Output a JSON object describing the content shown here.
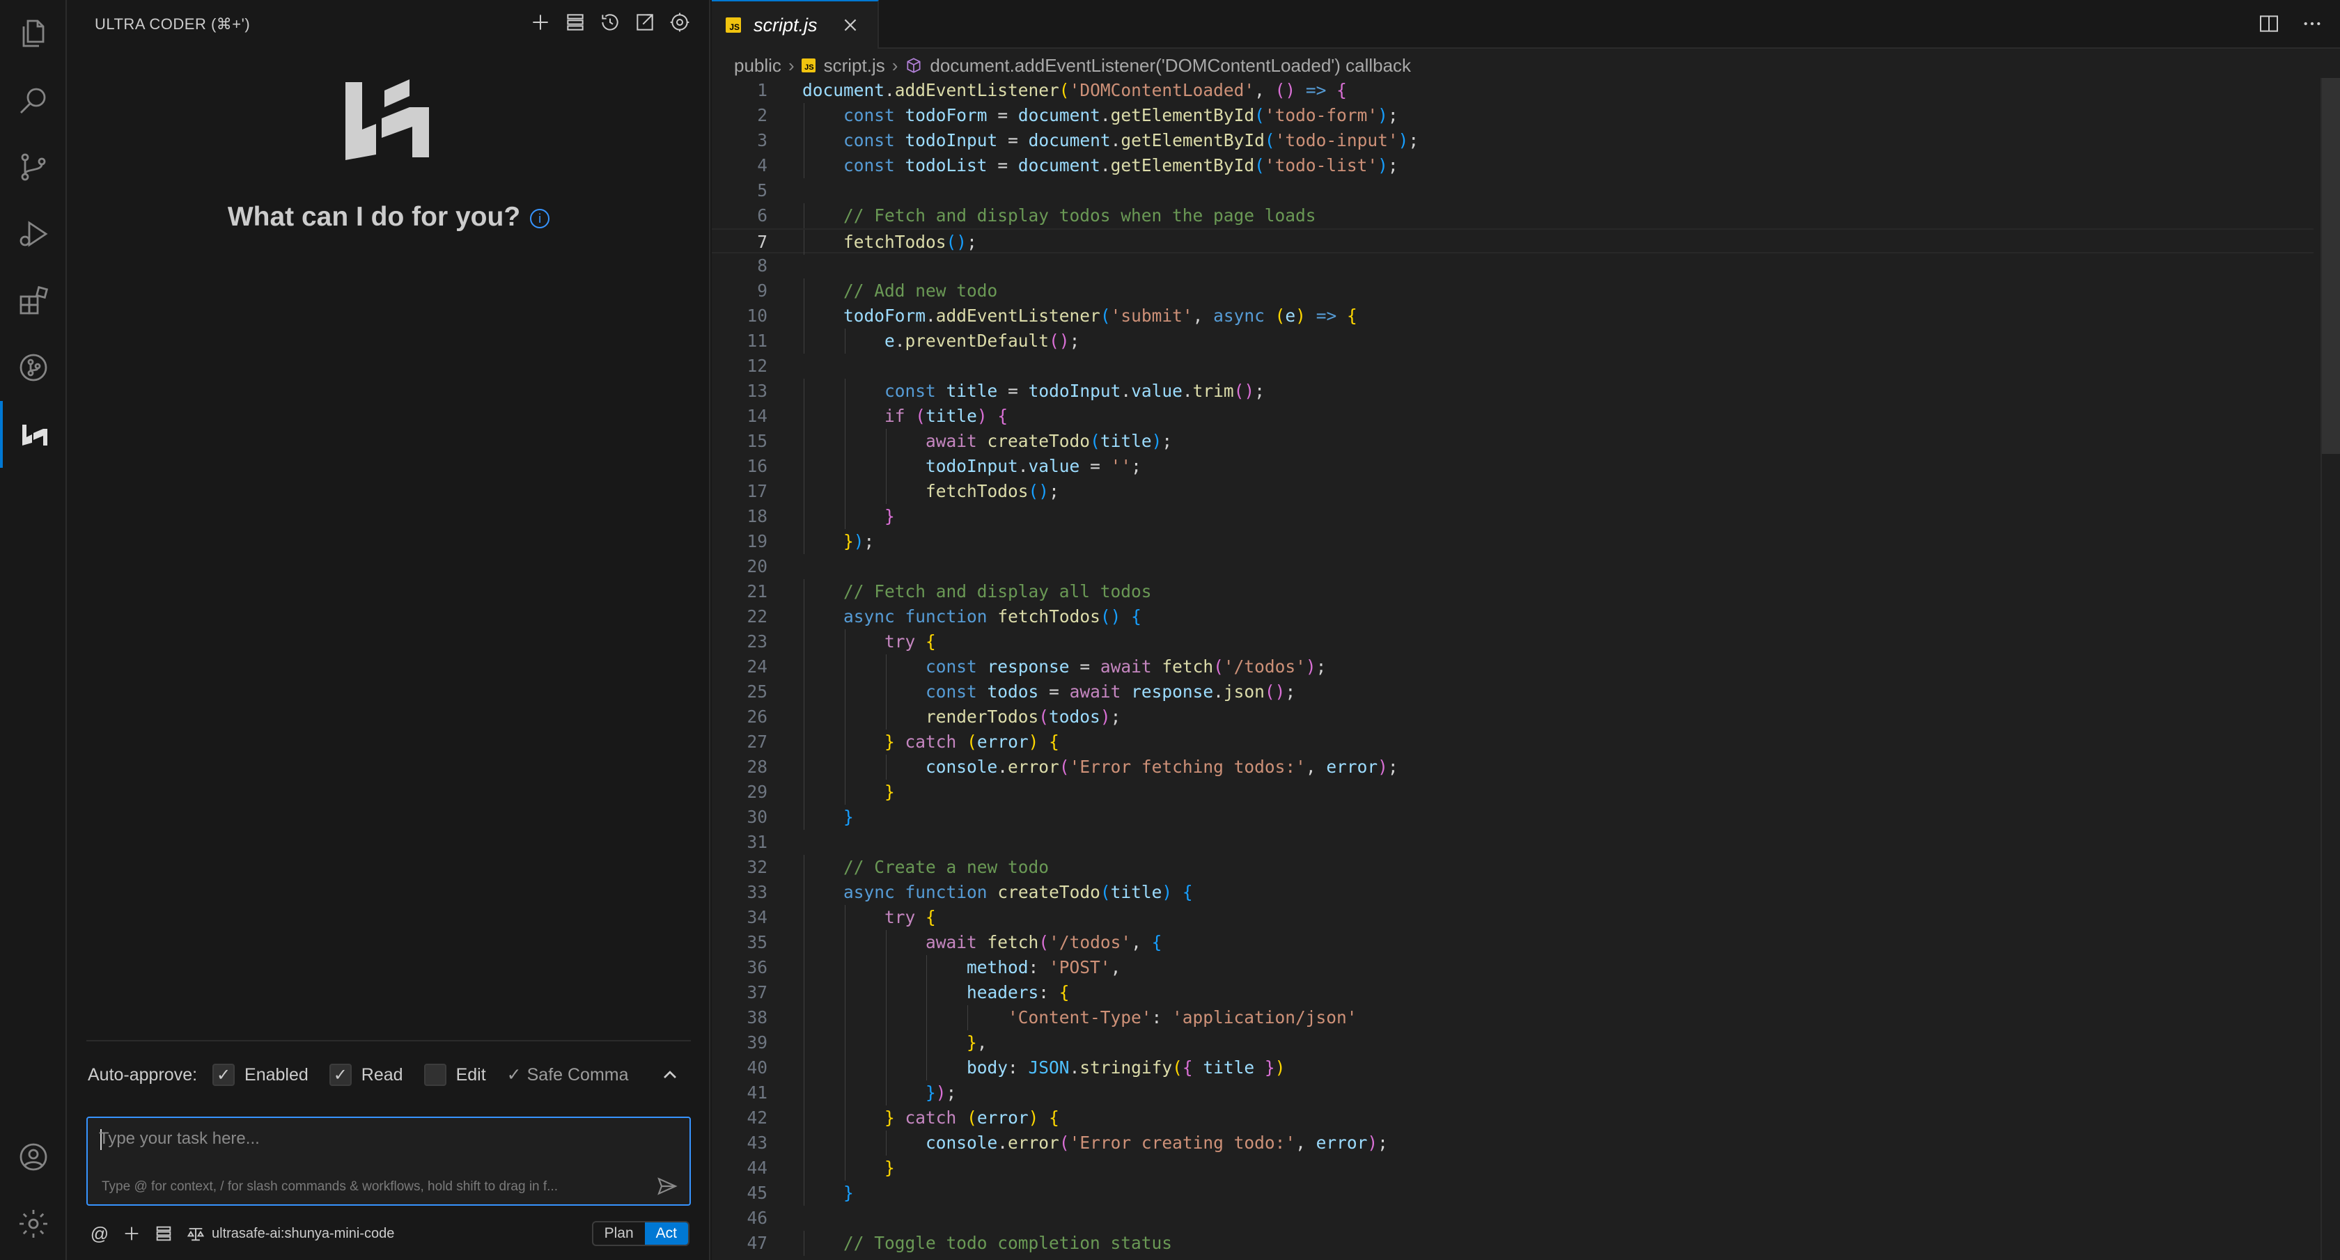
{
  "sidebar": {
    "title": "ULTRA CODER (⌘+')",
    "greeting": "What can I do for you?",
    "auto_approve": {
      "label": "Auto-approve:",
      "items": [
        {
          "label": "Enabled",
          "checked": true
        },
        {
          "label": "Read",
          "checked": true
        },
        {
          "label": "Edit",
          "checked": false
        }
      ],
      "safe_commands": "Safe Comma"
    },
    "task_input": {
      "placeholder": "Type your task here...",
      "hint": "Type @ for context, / for slash commands & workflows, hold shift to drag in f..."
    },
    "model": "ultrasafe-ai:shunya-mini-code",
    "mode": {
      "plan": "Plan",
      "act": "Act",
      "selected": "Act"
    }
  },
  "editor": {
    "tab": {
      "file_name": "script.js",
      "badge": "JS"
    },
    "breadcrumb": {
      "folder": "public",
      "file": "script.js",
      "symbol": "document.addEventListener('DOMContentLoaded') callback"
    },
    "current_line": 7,
    "code_lines": [
      "document.addEventListener('DOMContentLoaded', () => {",
      "    const todoForm = document.getElementById('todo-form');",
      "    const todoInput = document.getElementById('todo-input');",
      "    const todoList = document.getElementById('todo-list');",
      "",
      "    // Fetch and display todos when the page loads",
      "    fetchTodos();",
      "",
      "    // Add new todo",
      "    todoForm.addEventListener('submit', async (e) => {",
      "        e.preventDefault();",
      "",
      "        const title = todoInput.value.trim();",
      "        if (title) {",
      "            await createTodo(title);",
      "            todoInput.value = '';",
      "            fetchTodos();",
      "        }",
      "    });",
      "",
      "    // Fetch and display all todos",
      "    async function fetchTodos() {",
      "        try {",
      "            const response = await fetch('/todos');",
      "            const todos = await response.json();",
      "            renderTodos(todos);",
      "        } catch (error) {",
      "            console.error('Error fetching todos:', error);",
      "        }",
      "    }",
      "",
      "    // Create a new todo",
      "    async function createTodo(title) {",
      "        try {",
      "            await fetch('/todos', {",
      "                method: 'POST',",
      "                headers: {",
      "                    'Content-Type': 'application/json'",
      "                },",
      "                body: JSON.stringify({ title })",
      "            });",
      "        } catch (error) {",
      "            console.error('Error creating todo:', error);",
      "        }",
      "    }",
      "",
      "    // Toggle todo completion status"
    ]
  },
  "colors": {
    "accent": "#0078d4",
    "keyword": "#569cd6",
    "string": "#ce9178",
    "comment": "#6a9955",
    "variable": "#9cdcfe",
    "function": "#dcdcaa"
  },
  "icons": {
    "activity": [
      "files-icon",
      "search-icon",
      "source-control-icon",
      "run-debug-icon",
      "extensions-icon",
      "git-graph-icon",
      "ultra-coder-icon",
      "account-icon",
      "settings-gear-icon"
    ]
  }
}
